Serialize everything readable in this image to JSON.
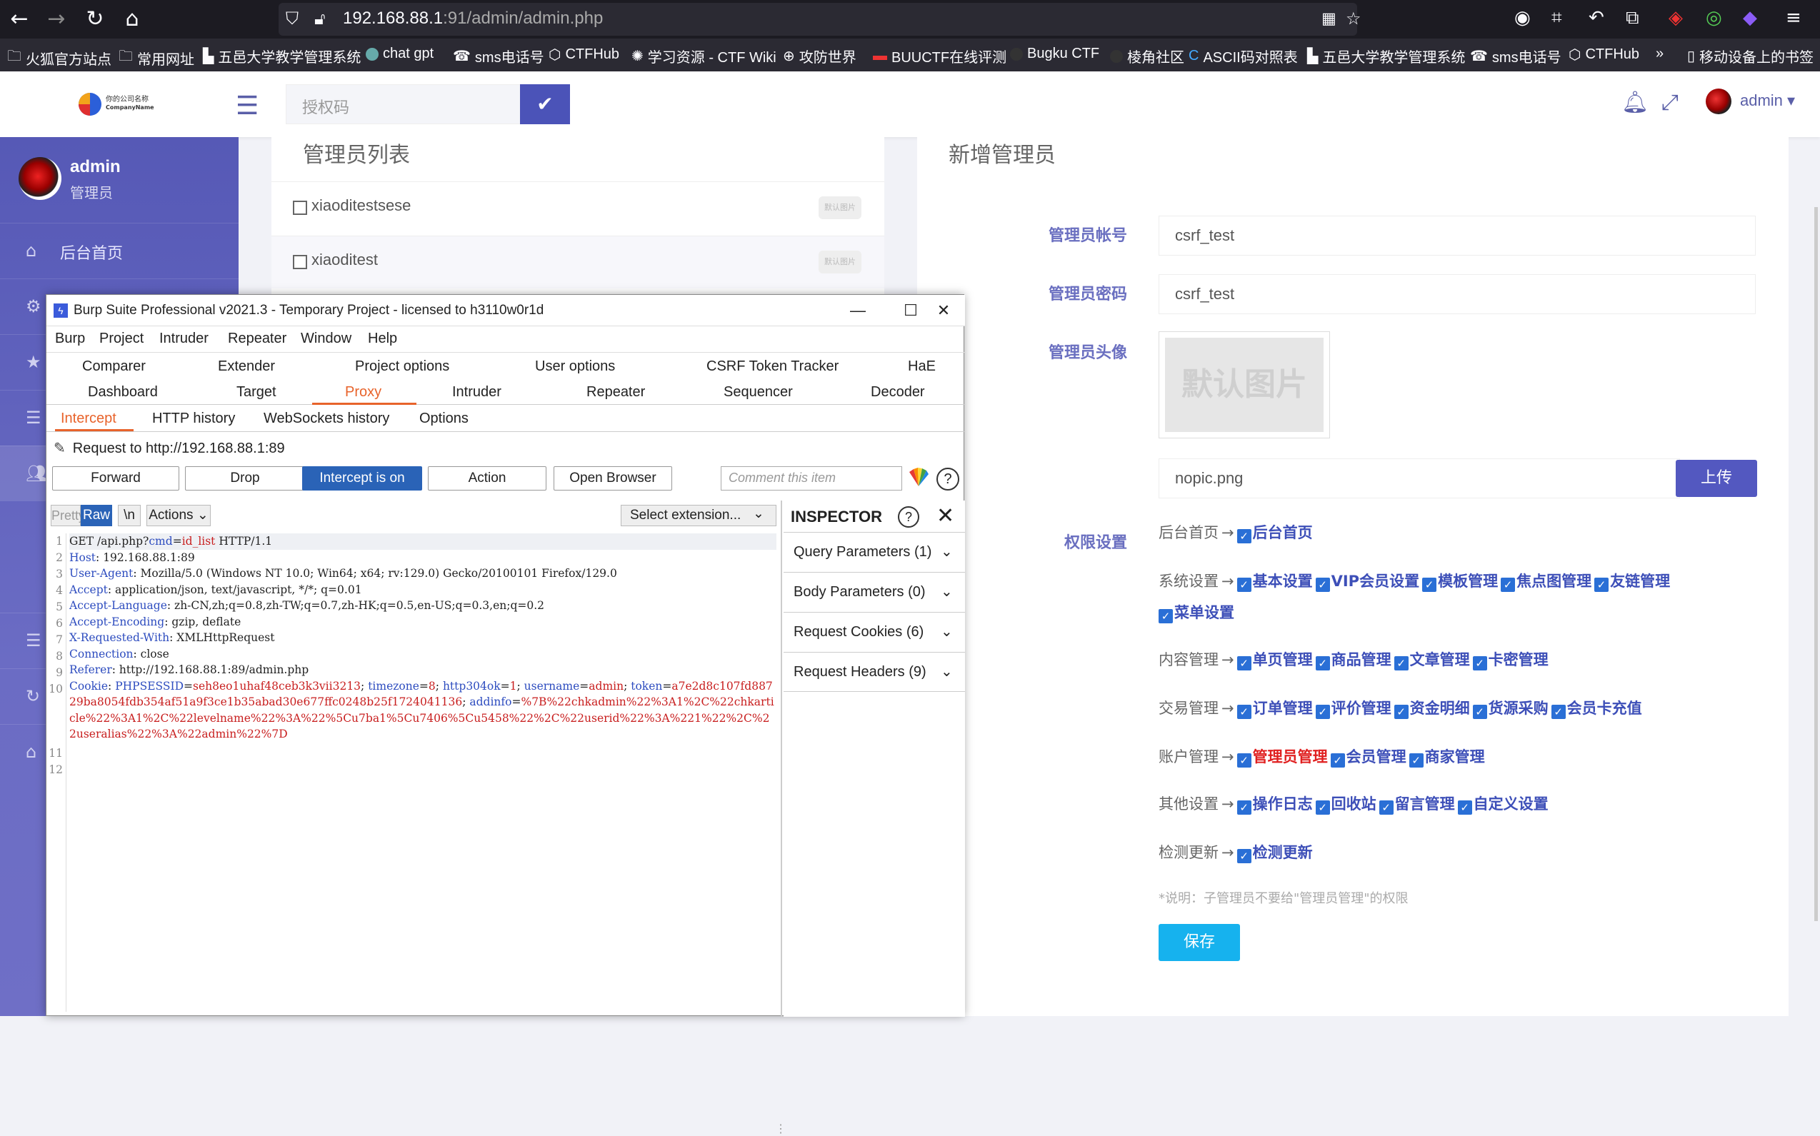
{
  "browser": {
    "url_host": "192.168.88.1",
    "url_rest": ":91/admin/admin.php",
    "bookmarks": [
      "火狐官方站点",
      "常用网址",
      "五邑大学教学管理系统",
      "chat gpt",
      "sms电话号",
      "CTFHub",
      "学习资源 - CTF Wiki",
      "攻防世界",
      "BUUCTF在线评测",
      "Bugku CTF",
      "棱角社区",
      "ASCII码对照表",
      "五邑大学教学管理系统",
      "sms电话号",
      "CTFHub",
      "移动设备上的书签"
    ]
  },
  "header": {
    "logo_text": "你的公司名称",
    "logo_sub": "CompanyName",
    "auth_placeholder": "授权码",
    "user": "admin"
  },
  "sidebar": {
    "name": "admin",
    "role": "管理员",
    "items": [
      {
        "label": "后台首页"
      }
    ]
  },
  "list": {
    "title": "管理员列表",
    "rows": [
      {
        "name": "xiaoditestsese",
        "thumb": "默认图片"
      },
      {
        "name": "xiaoditest",
        "thumb": "默认图片"
      }
    ]
  },
  "form": {
    "title": "新增管理员",
    "account_label": "管理员帐号",
    "account_value": "csrf_test",
    "password_label": "管理员密码",
    "password_value": "csrf_test",
    "avatar_label": "管理员头像",
    "avatar_placeholder": "默认图片",
    "avatar_file": "nopic.png",
    "upload_label": "上传",
    "perm_label": "权限设置",
    "perm_groups": [
      {
        "group": "后台首页",
        "items": [
          "后台首页"
        ]
      },
      {
        "group": "系统设置",
        "items": [
          "基本设置",
          "VIP会员设置",
          "模板管理",
          "焦点图管理",
          "友链管理"
        ]
      },
      {
        "group": "",
        "items": [
          "菜单设置"
        ]
      },
      {
        "group": "内容管理",
        "items": [
          "单页管理",
          "商品管理",
          "文章管理",
          "卡密管理"
        ]
      },
      {
        "group": "交易管理",
        "items": [
          "订单管理",
          "评价管理",
          "资金明细",
          "货源采购",
          "会员卡充值"
        ]
      },
      {
        "group": "账户管理",
        "items": [
          "管理员管理",
          "会员管理",
          "商家管理"
        ]
      },
      {
        "group": "其他设置",
        "items": [
          "操作日志",
          "回收站",
          "留言管理",
          "自定义设置"
        ]
      },
      {
        "group": "检测更新",
        "items": [
          "检测更新"
        ]
      }
    ],
    "note": "*说明：子管理员不要给\"管理员管理\"的权限",
    "save_label": "保存"
  },
  "burp": {
    "title": "Burp Suite Professional v2021.3 - Temporary Project - licensed to h3110w0r1d",
    "menu": [
      "Burp",
      "Project",
      "Intruder",
      "Repeater",
      "Window",
      "Help"
    ],
    "tabs_row1": [
      "Comparer",
      "Extender",
      "Project options",
      "User options",
      "CSRF Token Tracker",
      "HaE"
    ],
    "tabs_row2": [
      "Dashboard",
      "Target",
      "Proxy",
      "Intruder",
      "Repeater",
      "Sequencer",
      "Decoder"
    ],
    "sub_tabs": [
      "Intercept",
      "HTTP history",
      "WebSockets history",
      "Options"
    ],
    "request_to": "Request to http://192.168.88.1:89",
    "buttons": {
      "forward": "Forward",
      "drop": "Drop",
      "intercept": "Intercept is on",
      "action": "Action",
      "open_browser": "Open Browser"
    },
    "comment_placeholder": "Comment this item",
    "editor_tabs": {
      "pretty": "Pretty",
      "raw": "Raw",
      "newline": "\\n",
      "actions": "Actions",
      "select_ext": "Select extension..."
    },
    "request_lines": [
      "GET /api.php?cmd=id_list HTTP/1.1",
      "Host: 192.168.88.1:89",
      "User-Agent: Mozilla/5.0 (Windows NT 10.0; Win64; x64; rv:129.0) Gecko/20100101 Firefox/129.0",
      "Accept: application/json, text/javascript, */*; q=0.01",
      "Accept-Language: zh-CN,zh;q=0.8,zh-TW;q=0.7,zh-HK;q=0.5,en-US;q=0.3,en;q=0.2",
      "Accept-Encoding: gzip, deflate",
      "X-Requested-With: XMLHttpRequest",
      "Connection: close",
      "Referer: http://192.168.88.1:89/admin.php",
      "Cookie: PHPSESSID=seh8eo1uhaf48ceb3k3vii3213; timezone=8; http304ok=1; username=admin; token=a7e2d8c107fd88729ba8054fdb354af51a9f3ce1b35abad30e677ffc0248b25f1724041136; addinfo=%7B%22chkadmin%22%3A1%2C%22chkarticle%22%3A1%2C%22levelname%22%3A%22%5Cu7ba1%5Cu7406%5Cu5458%22%2C%22userid%22%3A%221%22%2C%22useralias%22%3A%22admin%22%7D",
      "",
      ""
    ],
    "inspector": {
      "title": "INSPECTOR",
      "sections": [
        "Query Parameters (1)",
        "Body Parameters (0)",
        "Request Cookies (6)",
        "Request Headers (9)"
      ]
    }
  }
}
